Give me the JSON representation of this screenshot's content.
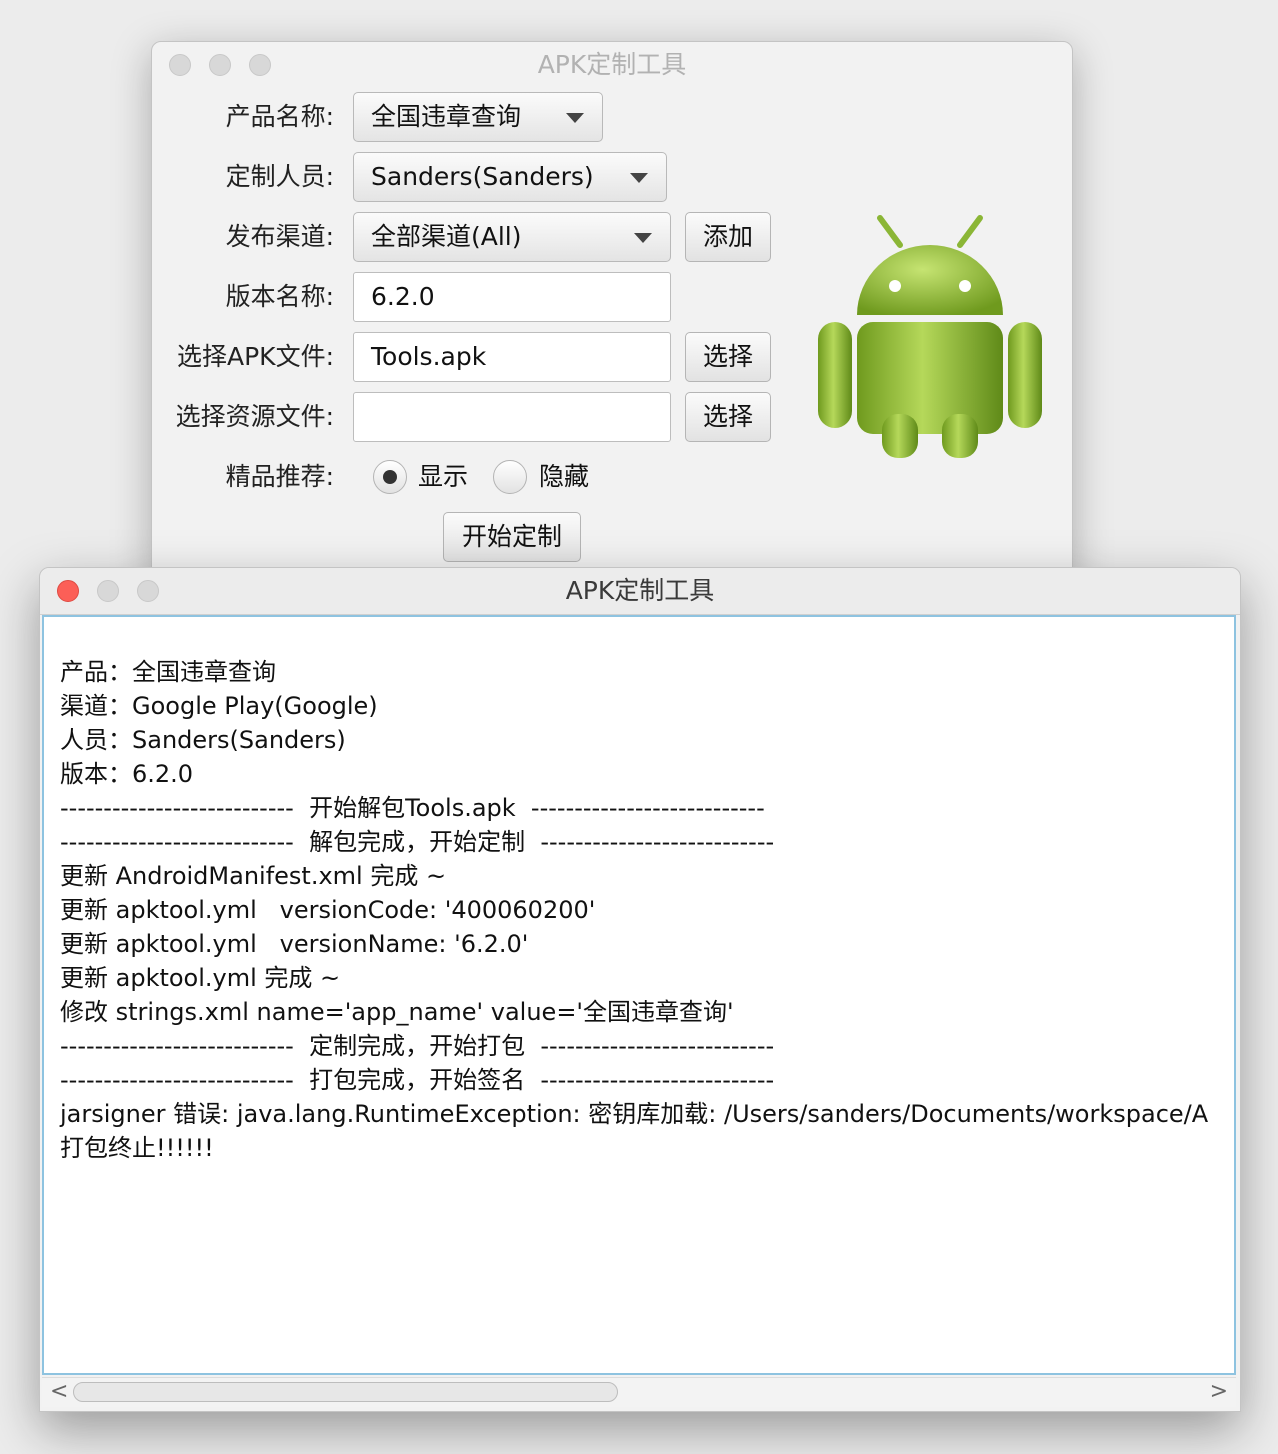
{
  "config_window": {
    "title": "APK定制工具",
    "product_label": "产品名称:",
    "product_value": "全国违章查询",
    "person_label": "定制人员:",
    "person_value": "Sanders(Sanders)",
    "channel_label": "发布渠道:",
    "channel_value": "全部渠道(All)",
    "add_button": "添加",
    "version_label": "版本名称:",
    "version_value": "6.2.0",
    "apk_label": "选择APK文件:",
    "apk_value": "Tools.apk",
    "apk_choose_button": "选择",
    "res_label": "选择资源文件:",
    "res_value": "",
    "res_choose_button": "选择",
    "recommend_label": "精品推荐:",
    "recommend_options": [
      "显示",
      "隐藏"
    ],
    "recommend_selected": "显示",
    "start_button": "开始定制",
    "logo_icon": "android-robot-icon"
  },
  "log_window": {
    "title": "APK定制工具",
    "log_lines": [
      "产品：全国违章查询",
      "渠道：Google Play(Google)",
      "人员：Sanders(Sanders)",
      "版本：6.2.0",
      "---------------------------  开始解包Tools.apk  ---------------------------",
      "---------------------------  解包完成，开始定制  ---------------------------",
      "更新 AndroidManifest.xml 完成 ~",
      "更新 apktool.yml   versionCode: '400060200'",
      "更新 apktool.yml   versionName: '6.2.0'",
      "更新 apktool.yml 完成 ~",
      "修改 strings.xml name='app_name' value='全国违章查询'",
      "---------------------------  定制完成，开始打包  ---------------------------",
      "---------------------------  打包完成，开始签名  ---------------------------",
      "jarsigner 错误: java.lang.RuntimeException: 密钥库加载: /Users/sanders/Documents/workspace/A",
      "打包终止!!!!!!"
    ]
  },
  "colors": {
    "close_red": "#fc5f57",
    "android_green": "#9bc33a",
    "focus_border": "#8ec3e0"
  }
}
